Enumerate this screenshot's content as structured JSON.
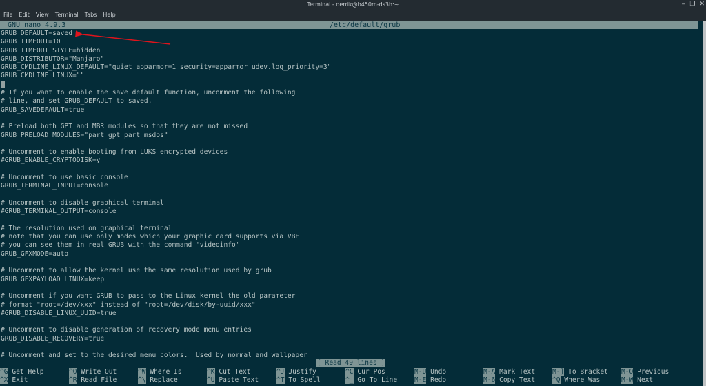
{
  "window": {
    "title": "Terminal - derrik@b450m-ds3h:~",
    "controls": [
      "minimize-icon",
      "restore-icon",
      "close-icon"
    ],
    "control_glyphs": [
      "‒",
      "❐",
      "✕"
    ]
  },
  "menubar": [
    "File",
    "Edit",
    "View",
    "Terminal",
    "Tabs",
    "Help"
  ],
  "nano": {
    "version": "GNU nano 4.9.3",
    "filename": "/etc/default/grub",
    "status": "[ Read 49 lines ]"
  },
  "lines": [
    "GRUB_DEFAULT=saved",
    "GRUB_TIMEOUT=10",
    "GRUB_TIMEOUT_STYLE=hidden",
    "GRUB_DISTRIBUTOR=\"Manjaro\"",
    "GRUB_CMDLINE_LINUX_DEFAULT=\"quiet apparmor=1 security=apparmor udev.log_priority=3\"",
    "GRUB_CMDLINE_LINUX=\"\"",
    "",
    "# If you want to enable the save default function, uncomment the following",
    "# line, and set GRUB_DEFAULT to saved.",
    "GRUB_SAVEDEFAULT=true",
    "",
    "# Preload both GPT and MBR modules so that they are not missed",
    "GRUB_PRELOAD_MODULES=\"part_gpt part_msdos\"",
    "",
    "# Uncomment to enable booting from LUKS encrypted devices",
    "#GRUB_ENABLE_CRYPTODISK=y",
    "",
    "# Uncomment to use basic console",
    "GRUB_TERMINAL_INPUT=console",
    "",
    "# Uncomment to disable graphical terminal",
    "#GRUB_TERMINAL_OUTPUT=console",
    "",
    "# The resolution used on graphical terminal",
    "# note that you can use only modes which your graphic card supports via VBE",
    "# you can see them in real GRUB with the command 'videoinfo'",
    "GRUB_GFXMODE=auto",
    "",
    "# Uncomment to allow the kernel use the same resolution used by grub",
    "GRUB_GFXPAYLOAD_LINUX=keep",
    "",
    "# Uncomment if you want GRUB to pass to the Linux kernel the old parameter",
    "# format \"root=/dev/xxx\" instead of \"root=/dev/disk/by-uuid/xxx\"",
    "#GRUB_DISABLE_LINUX_UUID=true",
    "",
    "# Uncomment to disable generation of recovery mode menu entries",
    "GRUB_DISABLE_RECOVERY=true",
    "",
    "# Uncomment and set to the desired menu colors.  Used by normal and wallpaper"
  ],
  "cursor_line": 6,
  "shortcuts": [
    [
      {
        "key": "^G",
        "label": "Get Help"
      },
      {
        "key": "^X",
        "label": "Exit"
      }
    ],
    [
      {
        "key": "^O",
        "label": "Write Out"
      },
      {
        "key": "^R",
        "label": "Read File"
      }
    ],
    [
      {
        "key": "^W",
        "label": "Where Is"
      },
      {
        "key": "^\\",
        "label": "Replace"
      }
    ],
    [
      {
        "key": "^K",
        "label": "Cut Text"
      },
      {
        "key": "^U",
        "label": "Paste Text"
      }
    ],
    [
      {
        "key": "^J",
        "label": "Justify"
      },
      {
        "key": "^T",
        "label": "To Spell"
      }
    ],
    [
      {
        "key": "^C",
        "label": "Cur Pos"
      },
      {
        "key": "^_",
        "label": "Go To Line"
      }
    ],
    [
      {
        "key": "M-U",
        "label": "Undo"
      },
      {
        "key": "M-E",
        "label": "Redo"
      }
    ],
    [
      {
        "key": "M-A",
        "label": "Mark Text"
      },
      {
        "key": "M-6",
        "label": "Copy Text"
      }
    ],
    [
      {
        "key": "M-]",
        "label": "To Bracket"
      },
      {
        "key": "^Q",
        "label": "Where Was"
      }
    ],
    [
      {
        "key": "M-Q",
        "label": "Previous"
      },
      {
        "key": "M-W",
        "label": "Next"
      }
    ]
  ],
  "annotation": {
    "type": "arrow",
    "color": "#e0141c",
    "points_to": "GRUB_DEFAULT=saved"
  }
}
